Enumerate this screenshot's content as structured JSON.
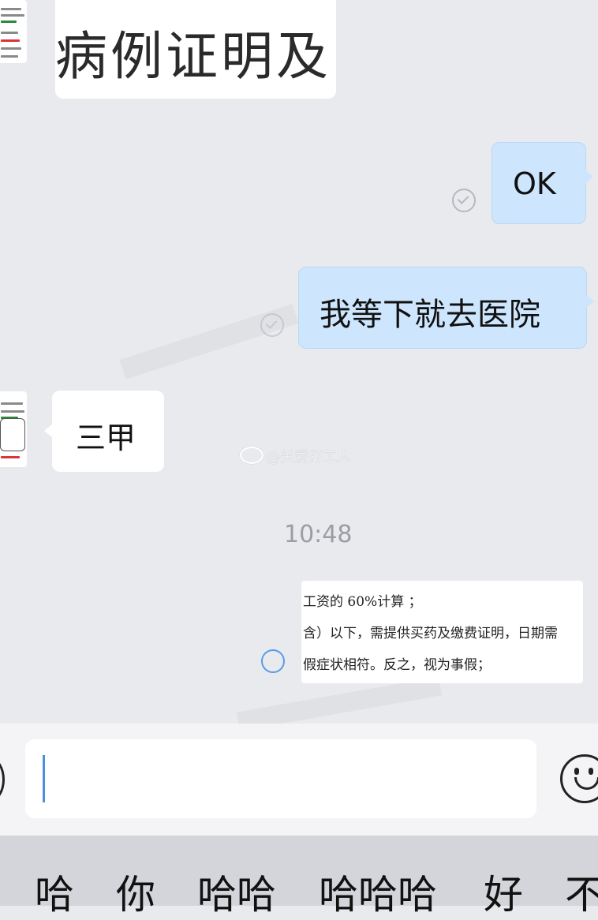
{
  "messages": {
    "top_image_text": "病例证明及",
    "ok": "OK",
    "go_hospital": "我等下就去医院",
    "sanjia": "三甲",
    "timestamp": "10:48",
    "doc_lines": [
      "工资的 60%计算 ；",
      "含）以下，需提供买药及缴费证明，日期需",
      "假症状相符。反之，视为事假；"
    ]
  },
  "watermark": {
    "text": "@关爱打工人"
  },
  "input": {
    "value": ""
  },
  "keyboard": {
    "suggestions": [
      "哈",
      "你",
      "哈哈",
      "哈哈哈",
      "好",
      "不"
    ]
  },
  "icons": {
    "read": "read-check-icon",
    "unread": "unread-circle-icon",
    "emoji": "emoji-smile-icon",
    "weibo": "weibo-logo-icon"
  },
  "colors": {
    "background": "#e9eaee",
    "outgoing_bubble": "#cde6fd",
    "incoming_bubble": "#ffffff",
    "caret": "#4a90e2"
  }
}
